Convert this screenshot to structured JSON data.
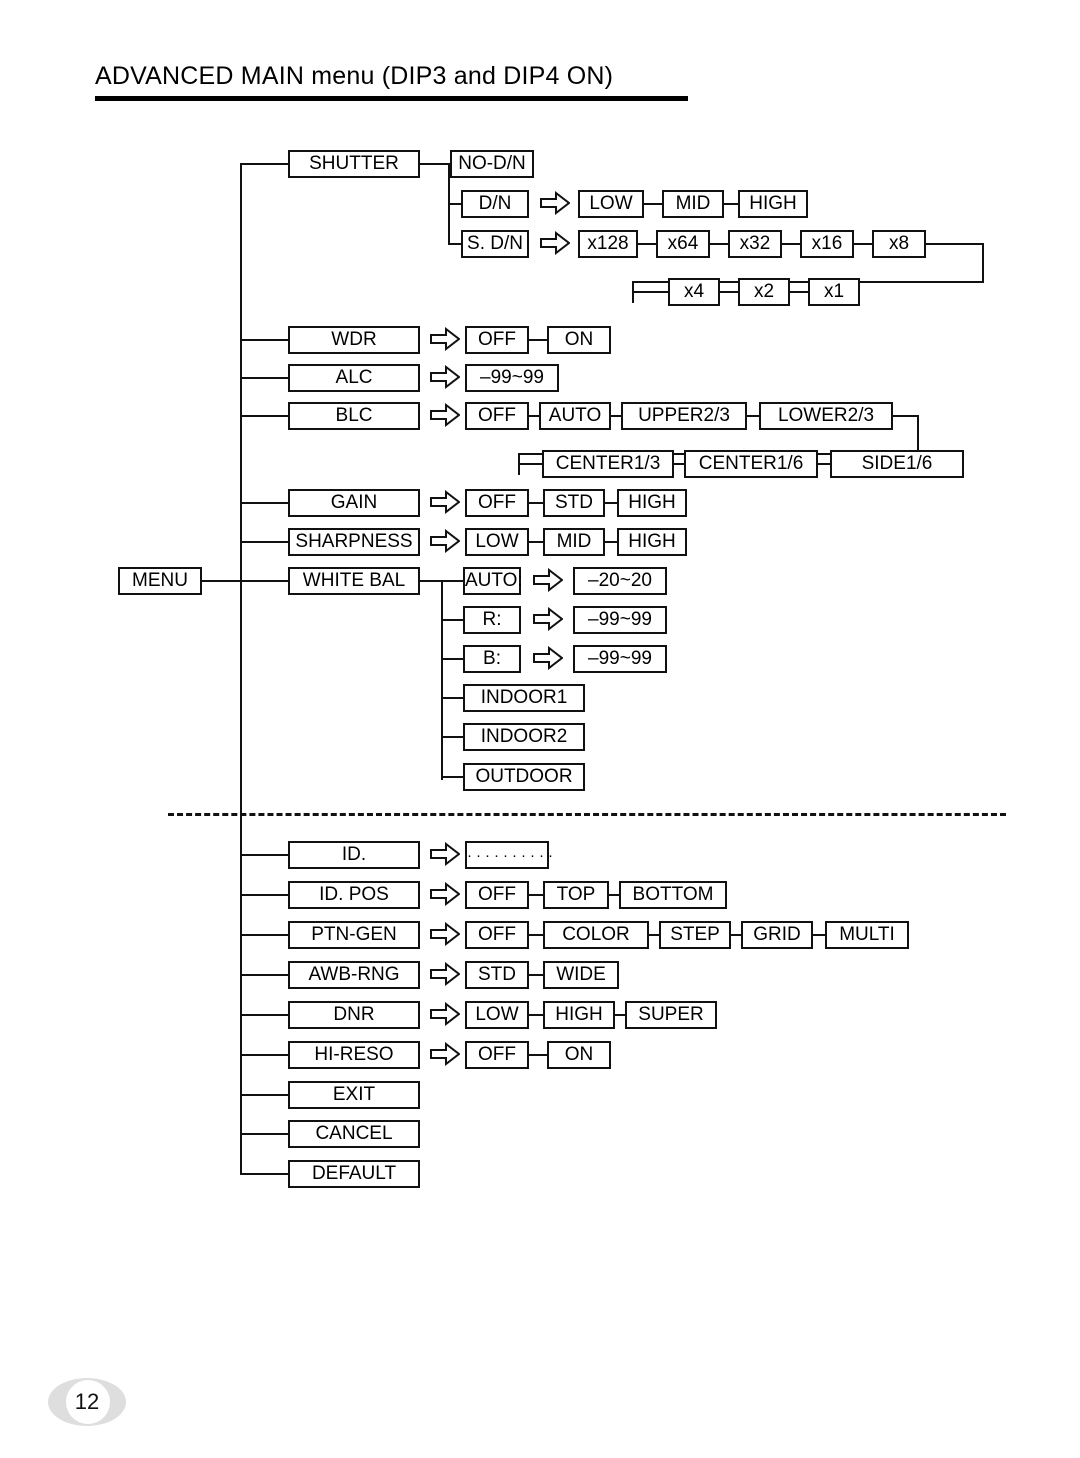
{
  "page": {
    "title": "ADVANCED MAIN menu (DIP3 and DIP4 ON)",
    "number": "12"
  },
  "root": {
    "label": "MENU"
  },
  "icons": {
    "arrow": "right-arrow-icon"
  },
  "menu": {
    "shutter": {
      "label": "SHUTTER",
      "options": [
        {
          "label": "NO-D/N"
        },
        {
          "label": "D/N",
          "values": [
            "LOW",
            "MID",
            "HIGH"
          ]
        },
        {
          "label": "S. D/N",
          "values": [
            "x128",
            "x64",
            "x32",
            "x16",
            "x8",
            "x4",
            "x2",
            "x1"
          ]
        }
      ]
    },
    "wdr": {
      "label": "WDR",
      "values": [
        "OFF",
        "ON"
      ]
    },
    "alc": {
      "label": "ALC",
      "values": [
        "–99~99"
      ]
    },
    "blc": {
      "label": "BLC",
      "values": [
        "OFF",
        "AUTO",
        "UPPER2/3",
        "LOWER2/3",
        "CENTER1/3",
        "CENTER1/6",
        "SIDE1/6"
      ]
    },
    "gain": {
      "label": "GAIN",
      "values": [
        "OFF",
        "STD",
        "HIGH"
      ]
    },
    "sharpness": {
      "label": "SHARPNESS",
      "values": [
        "LOW",
        "MID",
        "HIGH"
      ]
    },
    "white_bal": {
      "label": "WHITE BAL",
      "options": [
        {
          "label": "AUTO:",
          "value": "–20~20"
        },
        {
          "label": "R:",
          "value": "–99~99"
        },
        {
          "label": "B:",
          "value": "–99~99"
        },
        {
          "label": "INDOOR1"
        },
        {
          "label": "INDOOR2"
        },
        {
          "label": "OUTDOOR"
        }
      ]
    },
    "id": {
      "label": "ID.",
      "values": [
        "··········"
      ]
    },
    "id_pos": {
      "label": "ID. POS",
      "values": [
        "OFF",
        "TOP",
        "BOTTOM"
      ]
    },
    "ptn_gen": {
      "label": "PTN-GEN",
      "values": [
        "OFF",
        "COLOR",
        "STEP",
        "GRID",
        "MULTI"
      ]
    },
    "awb_rng": {
      "label": "AWB-RNG",
      "values": [
        "STD",
        "WIDE"
      ]
    },
    "dnr": {
      "label": "DNR",
      "values": [
        "LOW",
        "HIGH",
        "SUPER"
      ]
    },
    "hi_reso": {
      "label": "HI-RESO",
      "values": [
        "OFF",
        "ON"
      ]
    },
    "exit": {
      "label": "EXIT"
    },
    "cancel": {
      "label": "CANCEL"
    },
    "default": {
      "label": "DEFAULT"
    }
  }
}
